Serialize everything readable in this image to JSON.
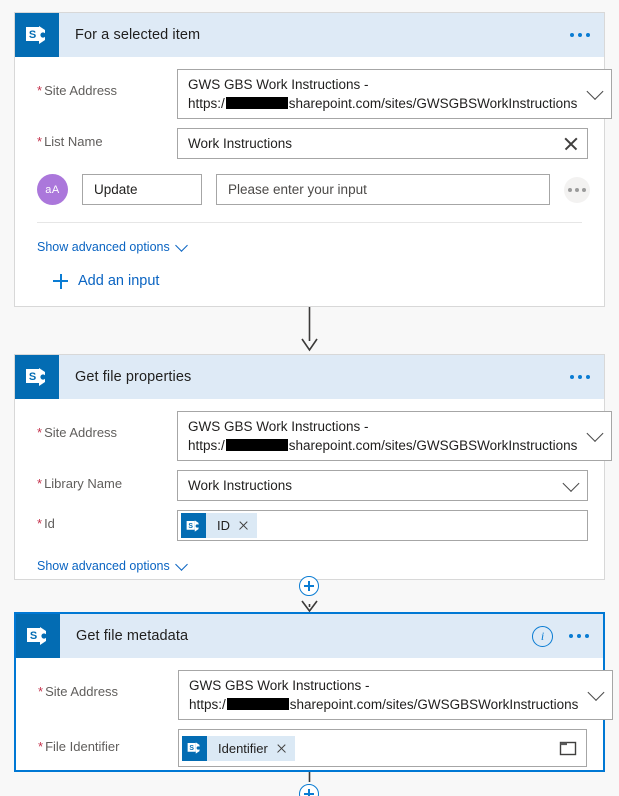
{
  "meta": {
    "accent_blue": "#0078d4",
    "header_blue": "#deeaf6",
    "sp_tile_blue": "#036cb3",
    "required_red": "#c4314b",
    "avatar_purple": "#ab77db"
  },
  "cards": [
    {
      "title": "For a selected item",
      "icon": "sharepoint-icon",
      "fields": [
        {
          "label": "Site Address",
          "required": true,
          "value_line1": "GWS GBS Work Instructions -",
          "value_line2_prefix": "https:/",
          "value_line2_suffix": "sharepoint.com/sites/GWSGBSWorkInstructions",
          "control": "dropdown"
        },
        {
          "label": "List Name",
          "required": true,
          "value": "Work Instructions",
          "control": "clearable"
        }
      ],
      "parameter": {
        "avatar_text": "aA",
        "name": "Update",
        "placeholder": "Please enter your input",
        "more_label": "..."
      },
      "advanced_label": "Show advanced options",
      "add_input_label": "Add an input"
    },
    {
      "title": "Get file properties",
      "icon": "sharepoint-icon",
      "fields": [
        {
          "label": "Site Address",
          "required": true,
          "value_line1": "GWS GBS Work Instructions -",
          "value_line2_prefix": "https:/",
          "value_line2_suffix": "sharepoint.com/sites/GWSGBSWorkInstructions",
          "control": "dropdown"
        },
        {
          "label": "Library Name",
          "required": true,
          "value": "Work Instructions",
          "control": "dropdown"
        },
        {
          "label": "Id",
          "required": true,
          "token": "ID",
          "control": "token"
        }
      ],
      "advanced_label": "Show advanced options"
    },
    {
      "title": "Get file metadata",
      "icon": "sharepoint-icon",
      "selected": true,
      "has_info_icon": true,
      "fields": [
        {
          "label": "Site Address",
          "required": true,
          "value_line1": "GWS GBS Work Instructions -",
          "value_line2_prefix": "https:/",
          "value_line2_suffix": "sharepoint.com/sites/GWSGBSWorkInstructions",
          "control": "dropdown"
        },
        {
          "label": "File Identifier",
          "required": true,
          "token": "Identifier",
          "control": "token-folder"
        }
      ]
    }
  ]
}
